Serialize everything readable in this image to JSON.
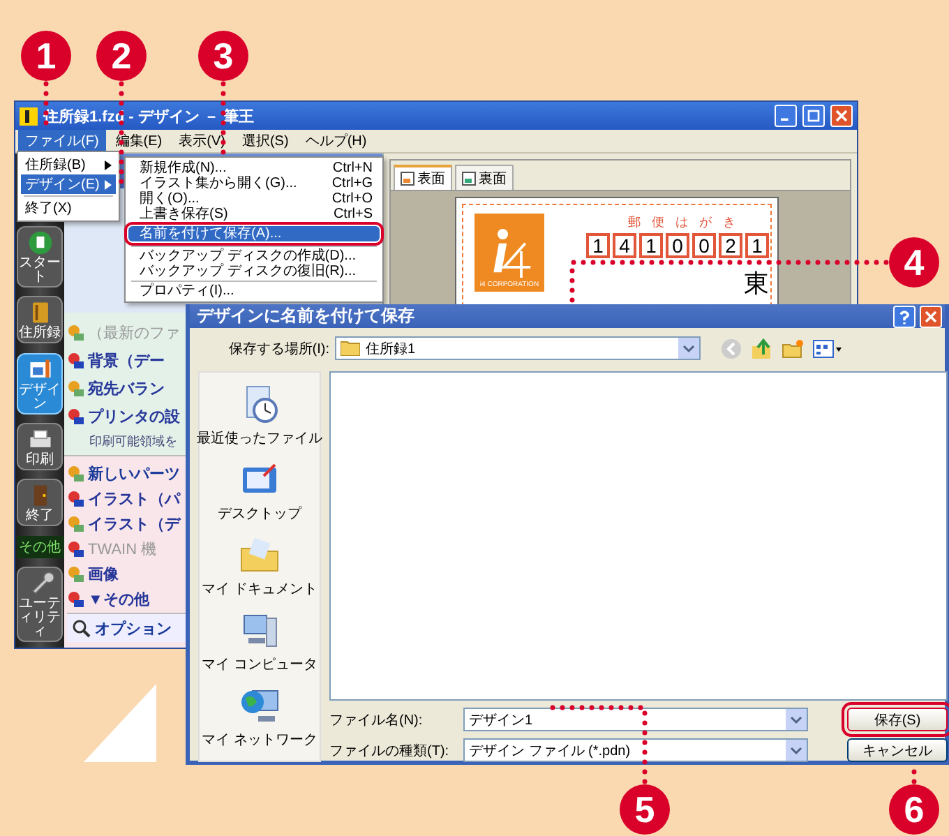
{
  "callouts": [
    {
      "number": "1"
    },
    {
      "number": "2"
    },
    {
      "number": "3"
    },
    {
      "number": "4"
    },
    {
      "number": "5"
    },
    {
      "number": "6"
    }
  ],
  "app_window": {
    "title": "住所録1.fzd - デザイン － 筆王",
    "menu": [
      {
        "label": "ファイル(F)",
        "selected": true
      },
      {
        "label": "編集(E)",
        "selected": false
      },
      {
        "label": "表示(V)",
        "selected": false
      },
      {
        "label": "選択(S)",
        "selected": false
      },
      {
        "label": "ヘルプ(H)",
        "selected": false
      }
    ],
    "toolbar": [
      {
        "kind": "tool",
        "label": "スタート",
        "selected": false
      },
      {
        "kind": "tool",
        "label": "住所録",
        "selected": false
      },
      {
        "kind": "tool",
        "label": "デザイン",
        "selected": true
      },
      {
        "kind": "tool",
        "label": "印刷",
        "selected": false
      },
      {
        "kind": "tool",
        "label": "終了",
        "selected": false
      },
      {
        "kind": "section",
        "label": "その他"
      },
      {
        "kind": "tool",
        "label": "ユーティリティ",
        "selected": false
      }
    ],
    "panel": {
      "tasks": [
        {
          "kind": "item",
          "label": "（最新のファ",
          "disabled": true
        },
        {
          "kind": "item",
          "label": "背景（デー",
          "disabled": false
        },
        {
          "kind": "item",
          "label": "宛先バラン",
          "disabled": false
        },
        {
          "kind": "item",
          "label": "プリンタの設",
          "disabled": false
        },
        {
          "kind": "note",
          "label": "印刷可能領域を",
          "disabled": false
        }
      ],
      "parts": [
        {
          "kind": "heading",
          "label": "新しいパーツ",
          "disabled": false
        },
        {
          "kind": "item",
          "label": "イラスト（パ",
          "disabled": false
        },
        {
          "kind": "item",
          "label": "イラスト（デ",
          "disabled": false
        },
        {
          "kind": "item",
          "label": "TWAIN 機",
          "disabled": true
        },
        {
          "kind": "item",
          "label": "画像",
          "disabled": false
        },
        {
          "kind": "item",
          "label": "▼その他",
          "disabled": false
        }
      ],
      "options": "オプション"
    },
    "preview": {
      "tabs": [
        {
          "label": "表面",
          "selected": true
        },
        {
          "label": "裏面",
          "selected": false
        }
      ],
      "postcard": {
        "heading": "郵便はがき",
        "postal_code": [
          "1",
          "4",
          "1",
          "0",
          "0",
          "2",
          "1"
        ],
        "logo_text": "i4 CORPORATION",
        "address": "東"
      }
    }
  },
  "file_menu": [
    [
      {
        "label": "住所録(B)",
        "submenu": true,
        "selected": false
      },
      {
        "label": "デザイン(E)",
        "submenu": true,
        "selected": true
      }
    ],
    [
      {
        "label": "終了(X)",
        "submenu": false,
        "selected": false
      }
    ]
  ],
  "design_submenu": [
    [
      {
        "label": "新規作成(N)...",
        "shortcut": "Ctrl+N",
        "selected": false
      },
      {
        "label": "イラスト集から開く(G)...",
        "shortcut": "Ctrl+G",
        "selected": false
      },
      {
        "label": "開く(O)...",
        "shortcut": "Ctrl+O",
        "selected": false
      },
      {
        "label": "上書き保存(S)",
        "shortcut": "Ctrl+S",
        "selected": false
      },
      {
        "label": "名前を付けて保存(A)...",
        "selected": true
      }
    ],
    [
      {
        "label": "バックアップ ディスクの作成(D)...",
        "selected": false
      },
      {
        "label": "バックアップ ディスクの復旧(R)...",
        "selected": false
      }
    ],
    [
      {
        "label": "プロパティ(I)...",
        "selected": false
      }
    ]
  ],
  "dialog": {
    "title": "デザインに名前を付けて保存",
    "location_label": "保存する場所(I):",
    "location": "住所録1",
    "places": [
      {
        "label": "最近使ったファイル"
      },
      {
        "label": "デスクトップ"
      },
      {
        "label": "マイ ドキュメント"
      },
      {
        "label": "マイ コンピュータ"
      },
      {
        "label": "マイ ネットワーク"
      }
    ],
    "file_name_label": "ファイル名(N):",
    "file_name": "デザイン1",
    "file_type_label": "ファイルの種類(T):",
    "file_type": "デザイン ファイル (*.pdn)",
    "buttons": [
      {
        "label": "保存(S)",
        "highlighted": true
      },
      {
        "label": "キャンセル",
        "highlighted": false
      }
    ]
  }
}
